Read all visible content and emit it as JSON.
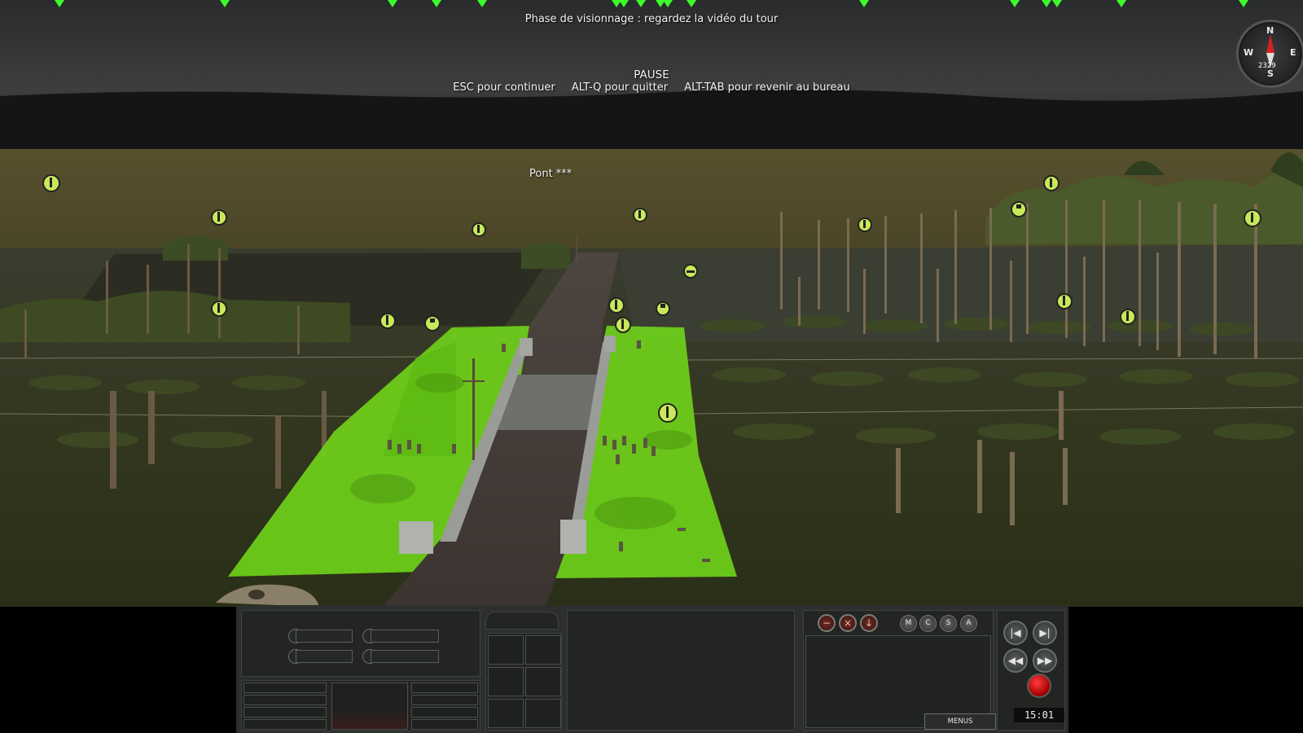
{
  "hud": {
    "phase_message": "Phase de visionnage : regardez la vidéo du tour",
    "pause_title": "PAUSE",
    "pause_hint_continue": "ESC pour continuer",
    "pause_hint_quit": "ALT-Q pour quitter",
    "pause_hint_desktop": "ALT-TAB pour revenir au bureau",
    "objective_label": "Pont ***"
  },
  "compass": {
    "north": "N",
    "south": "S",
    "east": "E",
    "west": "W",
    "altitude": "2329"
  },
  "control_panel": {
    "filter_buttons": [
      "M",
      "C",
      "S",
      "A"
    ],
    "order_icons": [
      "no-entry-icon",
      "cancel-icon",
      "deploy-icon"
    ],
    "playback_icons": [
      "skip-back-icon",
      "play-pause-icon",
      "rewind-icon",
      "fast-forward-icon"
    ],
    "menus_label": "MENUS",
    "clock": "15:01",
    "record_color": "#d40000"
  },
  "colors": {
    "unit_marker": "#c8e85a",
    "objective_green": "#6fd01a",
    "top_markers": "#3cff2a"
  }
}
